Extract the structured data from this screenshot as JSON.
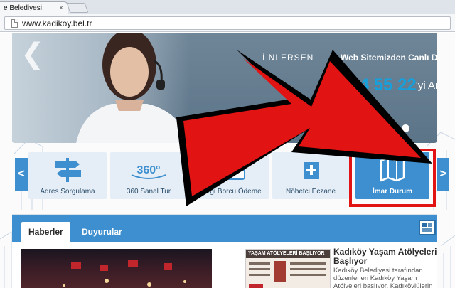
{
  "browser": {
    "tab_title": "e Belediyesi",
    "tab_close": "×",
    "url": "www.kadikoy.bel.tr"
  },
  "banner": {
    "prev_arrow": "❮",
    "line1": "İ NLERSEN",
    "line2": "Web Sitemizden Canlı D",
    "phone": "444 55 22",
    "phone_suffix": "'yi Araya",
    "slides": [
      false,
      false,
      false,
      false,
      true
    ]
  },
  "quick_links": {
    "prev": "<",
    "next": ">",
    "items": [
      {
        "label": "Adres Sorgulama",
        "icon": "signpost-icon"
      },
      {
        "label": "360 Sanal Tur",
        "icon": "360-icon"
      },
      {
        "label": "Vergi Borcu Ödeme",
        "icon": "credit-card-icon"
      },
      {
        "label": "Nöbetci Eczane",
        "icon": "pharmacy-icon"
      },
      {
        "label": "İmar Durum",
        "icon": "map-icon",
        "active": true
      }
    ]
  },
  "news": {
    "tabs": [
      "Haberler",
      "Duyurular"
    ],
    "thumb_heading": "YAŞAM ATÖLYELERİ BAŞLIYOR",
    "headline": "Kadıköy Yaşam Atölyeleri Başlıyor",
    "summary": "Kadıköy Belediyesi tarafından düzenlenen Kadıköy Yaşam Atölyeleri başlıyor. Kadıköylülerin"
  },
  "colors": {
    "accent": "#3d8fcf",
    "annotation": "#e21313"
  }
}
